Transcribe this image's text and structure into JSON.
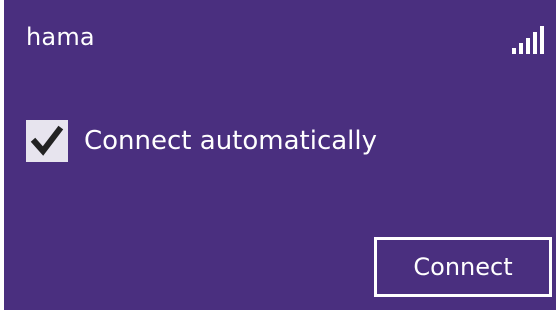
{
  "network": {
    "name": "hama",
    "signal_icon": "wifi-signal-bars-icon",
    "signal_level": 1.0
  },
  "options": {
    "connect_automatically_label": "Connect automatically",
    "connect_automatically_checked": true
  },
  "actions": {
    "connect_label": "Connect"
  },
  "colors": {
    "background": "#4a2f7f",
    "text": "#ffffff",
    "checkbox_fill": "#e7e4ee",
    "checkmark": "#222222"
  }
}
